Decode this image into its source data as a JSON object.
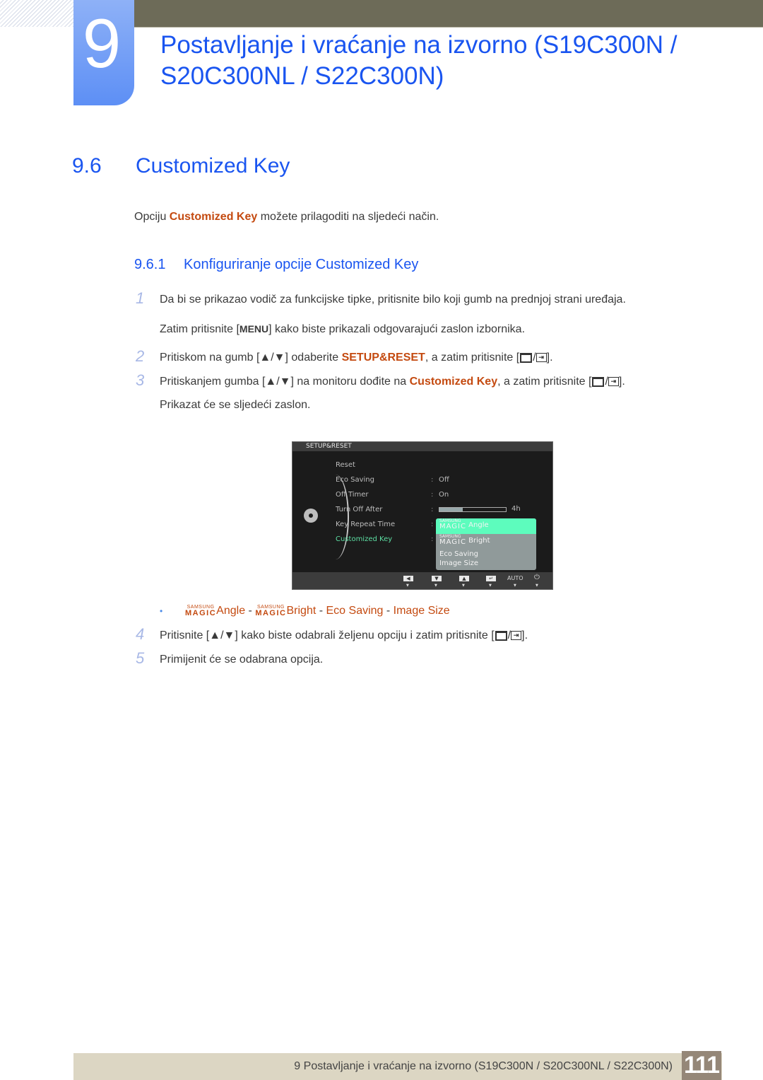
{
  "chapter": {
    "number": "9",
    "title_line1": "Postavljanje i vraćanje na izvorno (S19C300N /",
    "title_line2": "S20C300NL / S22C300N)"
  },
  "section": {
    "number": "9.6",
    "title": "Customized Key",
    "intro_before": "Opciju ",
    "intro_highlight": "Customized Key",
    "intro_after": " možete prilagoditi na sljedeći način."
  },
  "subsection": {
    "number": "9.6.1",
    "title": "Konfiguriranje opcije Customized Key"
  },
  "steps": [
    {
      "num": "1",
      "text": "Da bi se prikazao vodič za funkcijske tipke, pritisnite bilo koji gumb na prednjoj strani uređaja."
    },
    {
      "num": "",
      "before": "Zatim pritisnite [",
      "key": "MENU",
      "after": "] kako biste prikazali odgovarajući zaslon izbornika."
    },
    {
      "num": "2",
      "before": "Pritiskom na gumb [",
      "arrows": "▲/▼",
      "mid": "] odaberite ",
      "highlight": "SETUP&RESET",
      "after": ", a zatim pritisnite [",
      "end": "]."
    },
    {
      "num": "3",
      "before": "Pritiskanjem gumba [",
      "arrows": "▲/▼",
      "mid": "] na monitoru dođite na ",
      "highlight": "Customized Key",
      "after": ", a zatim pritisnite [",
      "end": "]."
    },
    {
      "num": "",
      "text": "Prikazat će se sljedeći zaslon."
    },
    {
      "num": "4",
      "before": "Pritisnite [",
      "arrows": "▲/▼",
      "mid": "] kako biste odabrali željenu opciju i zatim pritisnite [",
      "end": "]."
    },
    {
      "num": "5",
      "text": "Primijenit će se odabrana opcija."
    }
  ],
  "osd": {
    "header": "SETUP&RESET",
    "items": [
      {
        "label": "Reset",
        "value": ""
      },
      {
        "label": "Eco Saving",
        "value": "Off"
      },
      {
        "label": "Off Timer",
        "value": "On"
      },
      {
        "label": "Turn Off After",
        "value": "4h",
        "progress": 0.35
      },
      {
        "label": "Key Repeat Time",
        "value": ""
      },
      {
        "label": "Customized Key",
        "value": ""
      }
    ],
    "dropdown": {
      "options": [
        {
          "brand_top": "SAMSUNG",
          "brand_bottom": "MAGIC",
          "label": "Angle",
          "selected": true
        },
        {
          "brand_top": "SAMSUNG",
          "brand_bottom": "MAGIC",
          "label": "Bright",
          "selected": false
        },
        {
          "label": "Eco Saving",
          "selected": false
        },
        {
          "label": "Image Size",
          "selected": false
        }
      ]
    },
    "buttons": [
      {
        "icon": "left-arrow-icon",
        "glyph": "◀"
      },
      {
        "icon": "down-arrow-icon",
        "glyph": "▼"
      },
      {
        "icon": "up-arrow-icon",
        "glyph": "▲"
      },
      {
        "icon": "enter-icon",
        "glyph": "↵"
      },
      {
        "icon": "auto-label",
        "glyph": "AUTO"
      },
      {
        "icon": "power-icon",
        "glyph": "⏻"
      }
    ]
  },
  "bullet": {
    "brand_top": "SAMSUNG",
    "brand_bottom": "MAGIC",
    "opt1": "Angle",
    "opt2": "Bright",
    "opt3": "Eco Saving",
    "opt4": "Image Size",
    "separator": " - "
  },
  "footer": {
    "text": "9 Postavljanje i vraćanje na izvorno (S19C300N / S20C300NL / S22C300N)",
    "page": "111"
  },
  "colors": {
    "heading_blue": "#1a55f0",
    "highlight_orange": "#c44a10",
    "osd_active_green": "#5ddfa3",
    "osd_selected_bg": "#5dfcbd"
  }
}
